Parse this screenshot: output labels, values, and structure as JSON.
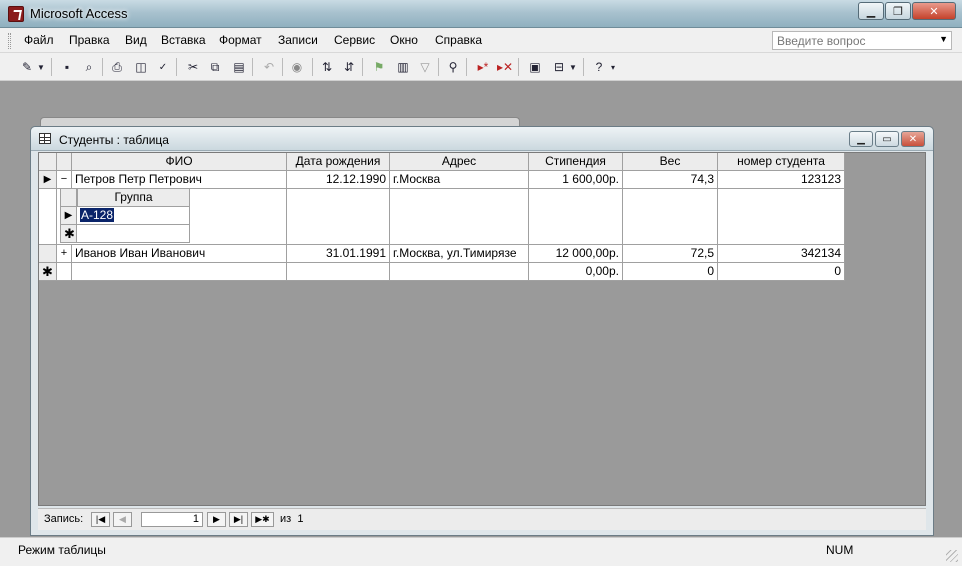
{
  "app": {
    "title": "Microsoft Access"
  },
  "menu": [
    "Файл",
    "Правка",
    "Вид",
    "Вставка",
    "Формат",
    "Записи",
    "Сервис",
    "Окно",
    "Справка"
  ],
  "ask_box": {
    "placeholder": "Введите вопрос"
  },
  "child": {
    "title": "Студенты : таблица"
  },
  "table": {
    "columns": [
      "ФИО",
      "Дата рождения",
      "Адрес",
      "Стипендия",
      "Вес",
      "номер студента"
    ],
    "rows": [
      {
        "expander": "−",
        "fio": "Петров Петр Петрович",
        "birth": "12.12.1990",
        "address": "г.Москва",
        "stipend": "1 600,00р.",
        "weight": "74,3",
        "number": "123123"
      },
      {
        "expander": "+",
        "fio": "Иванов Иван Иванович",
        "birth": "31.01.1991",
        "address": "г.Москва, ул.Тимирязе",
        "stipend": "12 000,00р.",
        "weight": "72,5",
        "number": "342134"
      }
    ],
    "new_row": {
      "stipend": "0,00р.",
      "weight": "0",
      "number": "0"
    },
    "subtable": {
      "column": "Группа",
      "value": "А-128"
    }
  },
  "nav": {
    "label": "Запись:",
    "current": "1",
    "of_label": "из",
    "total": "1"
  },
  "status": {
    "mode": "Режим таблицы",
    "num": "NUM"
  }
}
